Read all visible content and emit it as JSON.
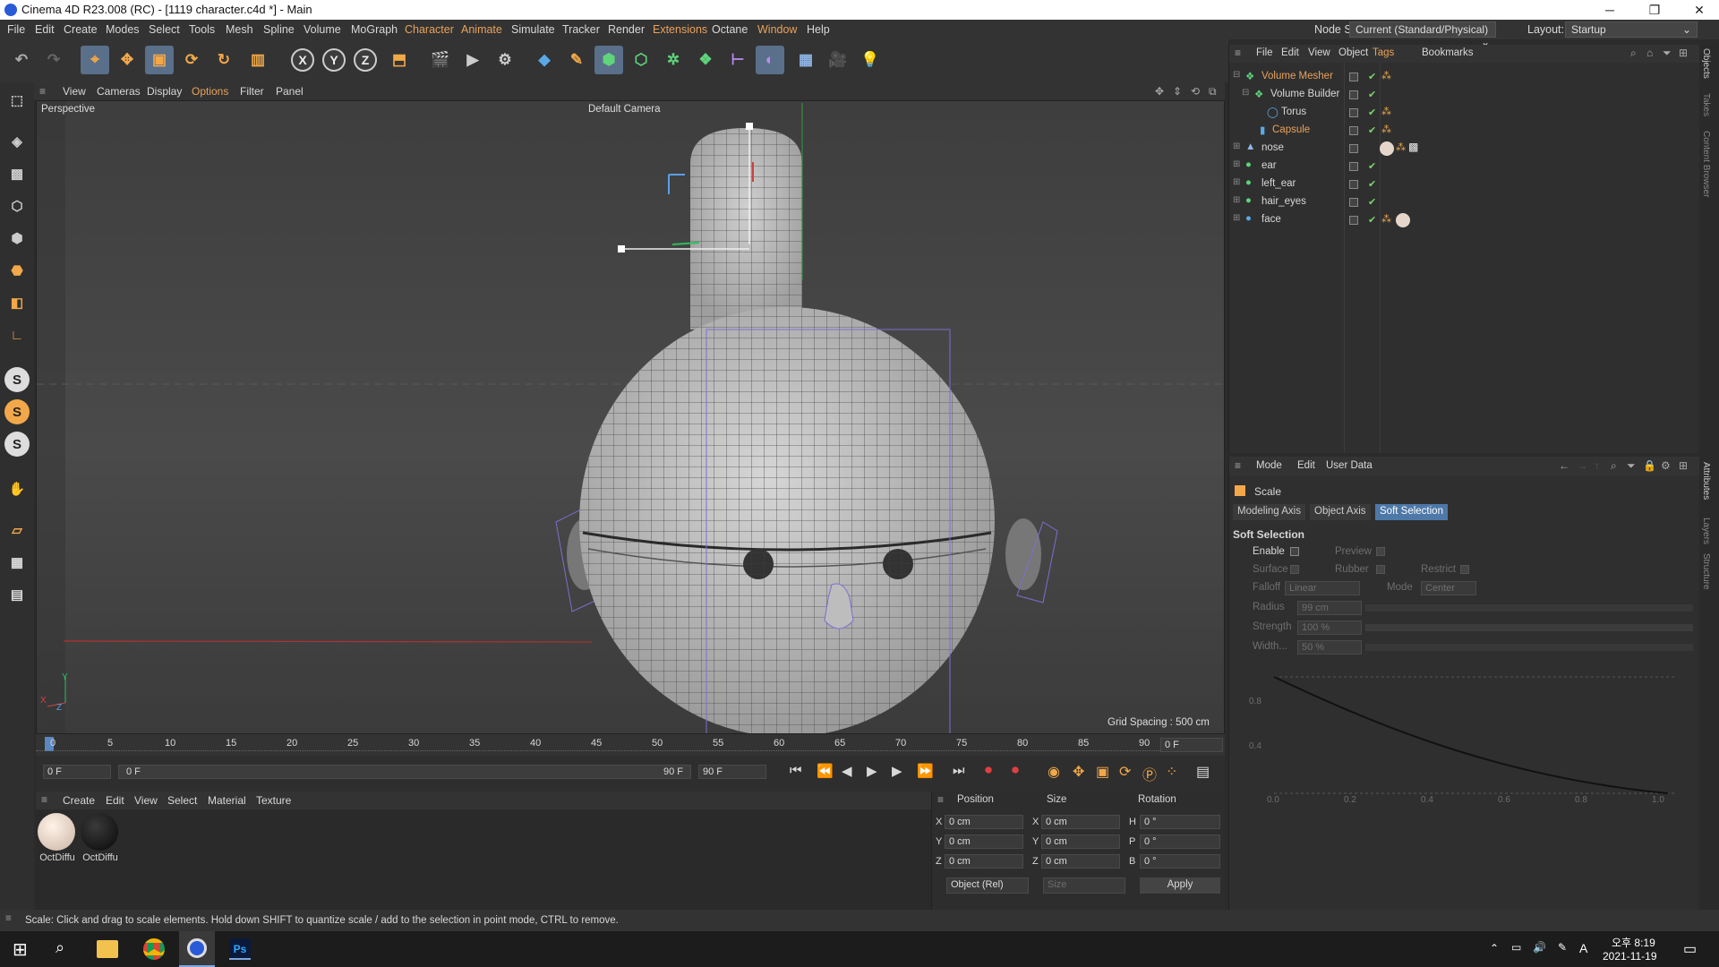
{
  "window": {
    "title": "Cinema 4D R23.008 (RC) - [1119 character.c4d *] - Main",
    "minimize": "─",
    "maximize": "❐",
    "close": "✕"
  },
  "menu": {
    "items": [
      "File",
      "Edit",
      "Create",
      "Modes",
      "Select",
      "Tools",
      "Mesh",
      "Spline",
      "Volume",
      "MoGraph",
      "Character",
      "Animate",
      "Simulate",
      "Tracker",
      "Render",
      "Extensions",
      "Octane",
      "Window",
      "Help"
    ],
    "node_space_label": "Node Space:",
    "node_space_value": "Current (Standard/Physical)",
    "layout_label": "Layout:",
    "layout_value": "Startup"
  },
  "viewport": {
    "menu": [
      "View",
      "Cameras",
      "Display",
      "Options",
      "Filter",
      "Panel"
    ],
    "label": "Perspective",
    "camera": "Default Camera",
    "grid_spacing": "Grid Spacing : 500 cm",
    "axis_x": "X",
    "axis_y": "Y",
    "axis_z": "Z"
  },
  "timeline": {
    "ticks": [
      "0",
      "5",
      "10",
      "15",
      "20",
      "25",
      "30",
      "35",
      "40",
      "45",
      "50",
      "55",
      "60",
      "65",
      "70",
      "75",
      "80",
      "85",
      "90"
    ],
    "current_frame": "0 F"
  },
  "transport": {
    "start_frame": "0 F",
    "range_start": "0 F",
    "range_end": "90 F",
    "end_frame": "90 F"
  },
  "materials": {
    "menu": [
      "Create",
      "Edit",
      "View",
      "Select",
      "Material",
      "Texture"
    ],
    "items": [
      {
        "name": "OctDiffu",
        "color": "#e8d8cc"
      },
      {
        "name": "OctDiffu",
        "color": "#1a1a1a"
      }
    ]
  },
  "coords": {
    "headers": [
      "Position",
      "Size",
      "Rotation"
    ],
    "rows": [
      {
        "axis": "X",
        "pos": "0 cm",
        "saxis": "X",
        "size": "0 cm",
        "raxis": "H",
        "rot": "0 °"
      },
      {
        "axis": "Y",
        "pos": "0 cm",
        "saxis": "Y",
        "size": "0 cm",
        "raxis": "P",
        "rot": "0 °"
      },
      {
        "axis": "Z",
        "pos": "0 cm",
        "saxis": "Z",
        "size": "0 cm",
        "raxis": "B",
        "rot": "0 °"
      }
    ],
    "mode": "Object (Rel)",
    "size_mode": "Size",
    "apply": "Apply"
  },
  "objects": {
    "menu": [
      "File",
      "Edit",
      "View",
      "Object",
      "Tags",
      "Bookmarks"
    ],
    "items": [
      {
        "name": "Volume Mesher",
        "indent": 0,
        "color": "#e8a25a"
      },
      {
        "name": "Volume Builder",
        "indent": 1,
        "color": "#dcdcdc"
      },
      {
        "name": "Torus",
        "indent": 2,
        "color": "#dcdcdc"
      },
      {
        "name": "Capsule",
        "indent": 2,
        "color": "#e8a25a"
      },
      {
        "name": "nose",
        "indent": 0,
        "color": "#dcdcdc"
      },
      {
        "name": "ear",
        "indent": 0,
        "color": "#dcdcdc"
      },
      {
        "name": "left_ear",
        "indent": 0,
        "color": "#dcdcdc"
      },
      {
        "name": "hair_eyes",
        "indent": 0,
        "color": "#dcdcdc"
      },
      {
        "name": "face",
        "indent": 0,
        "color": "#dcdcdc"
      }
    ]
  },
  "attributes": {
    "menu": [
      "Mode",
      "Edit",
      "User Data"
    ],
    "tool": "Scale",
    "tabs": [
      "Modeling Axis",
      "Object Axis",
      "Soft Selection"
    ],
    "section": "Soft Selection",
    "enable": "Enable",
    "preview": "Preview",
    "surface": "Surface",
    "rubber": "Rubber",
    "restrict": "Restrict",
    "falloff_label": "Falloff",
    "falloff_value": "Linear",
    "mode_label": "Mode",
    "mode_value": "Center",
    "radius_label": "Radius",
    "radius_value": "99 cm",
    "strength_label": "Strength",
    "strength_value": "100 %",
    "width_label": "Width...",
    "width_value": "50 %",
    "graph_y": [
      "0.8",
      "0.4"
    ],
    "graph_x": [
      "0.0",
      "0.2",
      "0.4",
      "0.6",
      "0.8",
      "1.0"
    ]
  },
  "side_tabs": [
    "Objects",
    "Takes",
    "Content Browser",
    "Attributes",
    "Layers",
    "Structure"
  ],
  "status": "Scale: Click and drag to scale elements. Hold down SHIFT to quantize scale / add to the selection in point mode, CTRL to remove.",
  "taskbar": {
    "time": "오후 8:19",
    "date": "2021-11-19",
    "lang": "A"
  }
}
